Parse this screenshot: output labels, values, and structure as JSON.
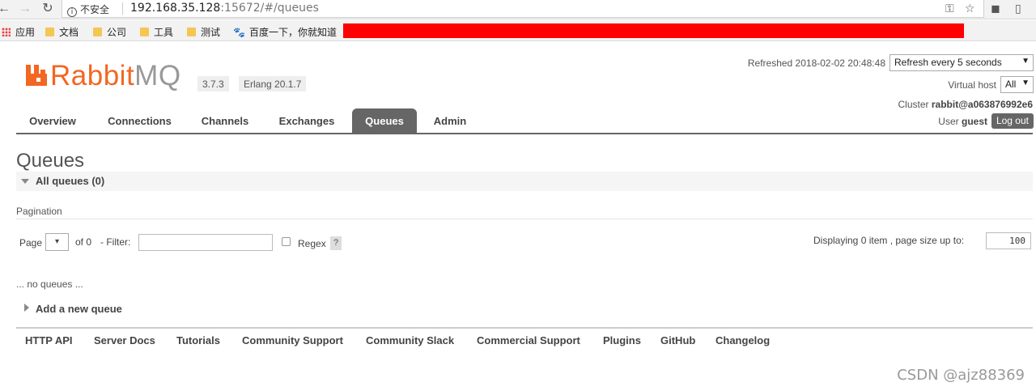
{
  "browser": {
    "security_label": "不安全",
    "url_main": "192.168.35.128",
    "url_rest": ":15672/#/queues",
    "bookmarks": [
      {
        "label": "应用"
      },
      {
        "label": "文档"
      },
      {
        "label": "公司"
      },
      {
        "label": "工具"
      },
      {
        "label": "测试"
      },
      {
        "label": "百度一下，你就知道"
      }
    ]
  },
  "header": {
    "logo_text_a": "Rabbit",
    "logo_text_b": "MQ",
    "version": "3.7.3",
    "erlang": "Erlang 20.1.7",
    "refreshed": "Refreshed 2018-02-02 20:48:48",
    "refresh_select": "Refresh every 5 seconds",
    "vhost_label": "Virtual host",
    "vhost_value": "All",
    "cluster_label": "Cluster",
    "cluster_name": "rabbit@a063876992e6",
    "user_label": "User",
    "user_name": "guest",
    "logout": "Log out"
  },
  "tabs": [
    {
      "label": "Overview"
    },
    {
      "label": "Connections"
    },
    {
      "label": "Channels"
    },
    {
      "label": "Exchanges"
    },
    {
      "label": "Queues"
    },
    {
      "label": "Admin"
    }
  ],
  "main": {
    "title": "Queues",
    "section": "All queues (0)",
    "pagination_label": "Pagination",
    "page_label": "Page",
    "page_select_icon": "▾",
    "of_label": "of 0",
    "filter_label": "- Filter:",
    "regex_label": "Regex",
    "help_label": "?",
    "displaying": "Displaying 0 item , page size up to:",
    "page_size": "100",
    "no_queues": "... no queues ...",
    "add_queue": "Add a new queue"
  },
  "footer": {
    "links": [
      {
        "label": "HTTP API"
      },
      {
        "label": "Server Docs"
      },
      {
        "label": "Tutorials"
      },
      {
        "label": "Community Support"
      },
      {
        "label": "Community Slack"
      },
      {
        "label": "Commercial Support"
      },
      {
        "label": "Plugins"
      },
      {
        "label": "GitHub"
      },
      {
        "label": "Changelog"
      }
    ]
  },
  "watermark": "CSDN @ajz88369",
  "colors": {
    "brand": "#f26722",
    "tab_active": "#666666",
    "redacted": "#ff0000"
  }
}
